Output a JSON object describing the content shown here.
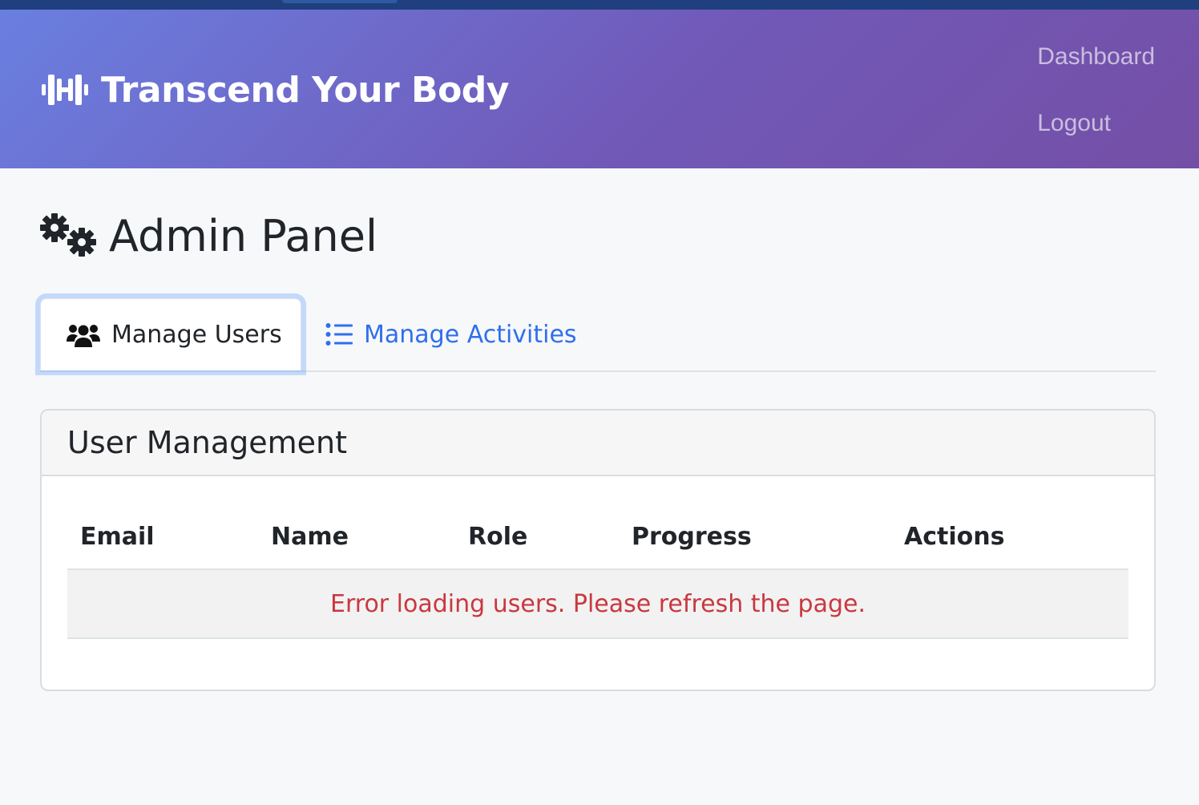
{
  "app": {
    "brand": "Transcend Your Body",
    "brand_icon": "dumbbell-icon"
  },
  "nav": {
    "links": [
      {
        "label": "Dashboard"
      },
      {
        "label": "Logout"
      }
    ]
  },
  "page": {
    "title": "Admin Panel",
    "title_icon": "gears-icon"
  },
  "tabs": [
    {
      "label": "Manage Users",
      "icon": "users-icon",
      "active": true
    },
    {
      "label": "Manage Activities",
      "icon": "list-icon",
      "active": false
    }
  ],
  "card": {
    "title": "User Management",
    "table": {
      "columns": [
        "Email",
        "Name",
        "Role",
        "Progress",
        "Actions"
      ],
      "rows": [],
      "error_message": "Error loading users. Please refresh the page."
    }
  },
  "colors": {
    "header_gradient_start": "#6a7fe0",
    "header_gradient_end": "#744fa6",
    "link_blue": "#2f6fed",
    "error_red": "#c9383f"
  }
}
